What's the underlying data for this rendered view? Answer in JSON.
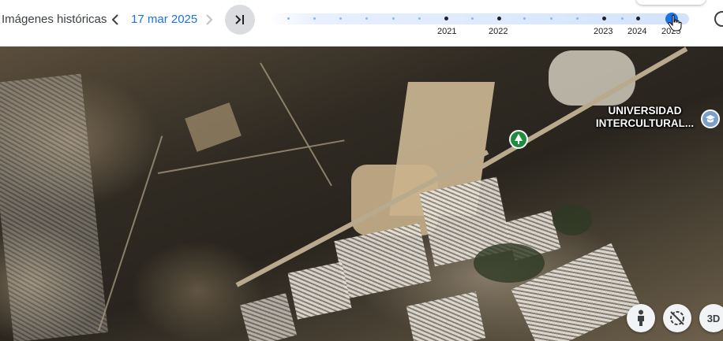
{
  "header": {
    "title": "Imágenes históricas",
    "date": "17 mar 2025",
    "prev_icon": "chevron-left-icon",
    "next_icon": "chevron-right-icon",
    "latest_icon": "skip-to-latest-icon"
  },
  "timeline": {
    "years": [
      "2021",
      "2022",
      "2023",
      "2024",
      "2025"
    ],
    "selected": "2025"
  },
  "map": {
    "poi_label": "UNIVERSIDAD\nINTERCULTURAL...",
    "poi_line1": "UNIVERSIDAD",
    "poi_line2": "INTERCULTURAL...",
    "park_icon": "tree-icon",
    "school_icon": "graduation-cap-icon"
  },
  "controls": {
    "pegman_icon": "pegman-icon",
    "compass_icon": "compass-off-icon",
    "view3d_label": "3D"
  },
  "colors": {
    "accent": "#1a73e8",
    "park_pin": "#1e8e3e"
  }
}
